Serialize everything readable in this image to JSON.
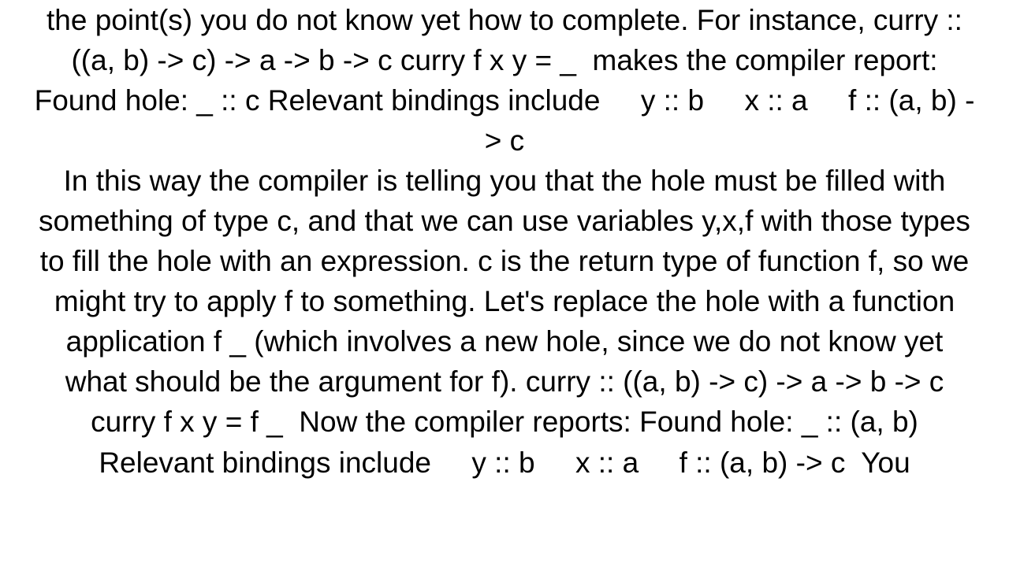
{
  "document": {
    "paragraphs": [
      "the point(s) you do not know yet how to complete. For instance, curry :: ((a, b) -> c) -> a -> b -> c curry f x y = _  makes the compiler report: Found hole: _ :: c Relevant bindings include     y :: b     x :: a     f :: (a, b) -> c",
      "In this way the compiler is telling you that the hole must be filled with something of type c, and that we can use variables y,x,f with those types to fill the hole with an expression. c is the return type of function f, so we might try to apply f to something. Let's replace the hole with a function application f _ (which involves a new hole, since we do not know yet what should be the argument for f). curry :: ((a, b) -> c) -> a -> b -> c curry f x y = f _  Now the compiler reports: Found hole: _ :: (a, b) Relevant bindings include     y :: b     x :: a     f :: (a, b) -> c  You"
    ]
  }
}
